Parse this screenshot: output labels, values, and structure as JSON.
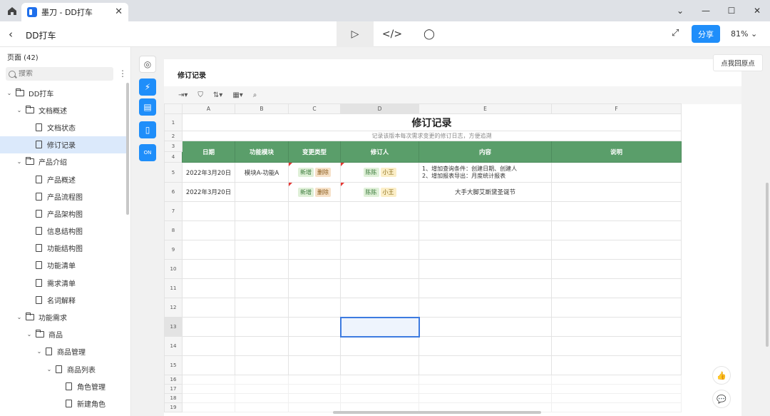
{
  "window": {
    "tab_title": "墨刀 - DD打车",
    "controls": [
      "⌄",
      "—",
      "☐",
      "✕"
    ]
  },
  "toolbar": {
    "project_name": "DD打车",
    "modes": [
      "▷",
      "</>",
      "◯"
    ],
    "share_label": "分享",
    "zoom": "81%"
  },
  "sidebar": {
    "pages_header": "页面 (42)",
    "search_placeholder": "搜索",
    "items": [
      {
        "label": "DD打车",
        "level": 0,
        "type": "folder",
        "caret": "⌄"
      },
      {
        "label": "文档概述",
        "level": 1,
        "type": "folder",
        "caret": "⌄"
      },
      {
        "label": "文档状态",
        "level": 2,
        "type": "page",
        "caret": ""
      },
      {
        "label": "修订记录",
        "level": 2,
        "type": "page",
        "caret": "",
        "selected": true
      },
      {
        "label": "产品介绍",
        "level": 1,
        "type": "folder",
        "caret": "⌄"
      },
      {
        "label": "产品概述",
        "level": 2,
        "type": "page",
        "caret": ""
      },
      {
        "label": "产品流程图",
        "level": 2,
        "type": "page",
        "caret": ""
      },
      {
        "label": "产品架构图",
        "level": 2,
        "type": "page",
        "caret": ""
      },
      {
        "label": "信息结构图",
        "level": 2,
        "type": "page",
        "caret": ""
      },
      {
        "label": "功能结构图",
        "level": 2,
        "type": "page",
        "caret": ""
      },
      {
        "label": "功能清单",
        "level": 2,
        "type": "page",
        "caret": ""
      },
      {
        "label": "需求清单",
        "level": 2,
        "type": "page",
        "caret": ""
      },
      {
        "label": "名词解释",
        "level": 2,
        "type": "page",
        "caret": ""
      },
      {
        "label": "功能需求",
        "level": 1,
        "type": "folder",
        "caret": "⌄"
      },
      {
        "label": "商品",
        "level": 2,
        "type": "folder",
        "caret": "⌄"
      },
      {
        "label": "商品管理",
        "level": 3,
        "type": "page",
        "caret": "⌄"
      },
      {
        "label": "商品列表",
        "level": 4,
        "type": "page",
        "caret": "⌄"
      },
      {
        "label": "角色管理",
        "level": 5,
        "type": "page",
        "caret": ""
      },
      {
        "label": "新建角色",
        "level": 5,
        "type": "page",
        "caret": ""
      }
    ]
  },
  "canvas": {
    "reset_label": "点我回原点",
    "doc_title": "修订记录",
    "sheet_tools": [
      "⇥▾",
      "⛉",
      "⇅▾",
      "▦▾",
      "⌕"
    ],
    "columns": [
      "A",
      "B",
      "C",
      "D",
      "E",
      "F"
    ],
    "sheet_title": "修订记录",
    "sheet_subtitle": "记录该版本每次需求变更的修订日志，方便追溯",
    "headers": [
      "日期",
      "功能模块",
      "变更类型",
      "修订人",
      "内容",
      "说明"
    ],
    "rows": [
      {
        "date": "2022年3月20日",
        "module": "模块A-功能A",
        "change_types": [
          "新增",
          "删除"
        ],
        "editors": [
          "陈陈",
          "小王"
        ],
        "content_1": "1、增加查询条件：创建日期、创建人",
        "content_2": "2、增加报表导出：月度统计报表",
        "note": ""
      },
      {
        "date": "2022年3月20日",
        "module": "",
        "change_types": [
          "新增",
          "删除"
        ],
        "editors": [
          "陈陈",
          "小王"
        ],
        "content_1": "大手大脚艾斯黛圣诞节",
        "content_2": "",
        "note": ""
      }
    ],
    "row_numbers": [
      "1",
      "2",
      "3",
      "4",
      "5",
      "6",
      "7",
      "8",
      "9",
      "10",
      "11",
      "12",
      "13",
      "14",
      "15",
      "16",
      "17",
      "18",
      "19"
    ]
  },
  "colors": {
    "accent": "#1f8efa",
    "header_green": "#5a9e6a",
    "selected_row": "#dbe9fb"
  }
}
